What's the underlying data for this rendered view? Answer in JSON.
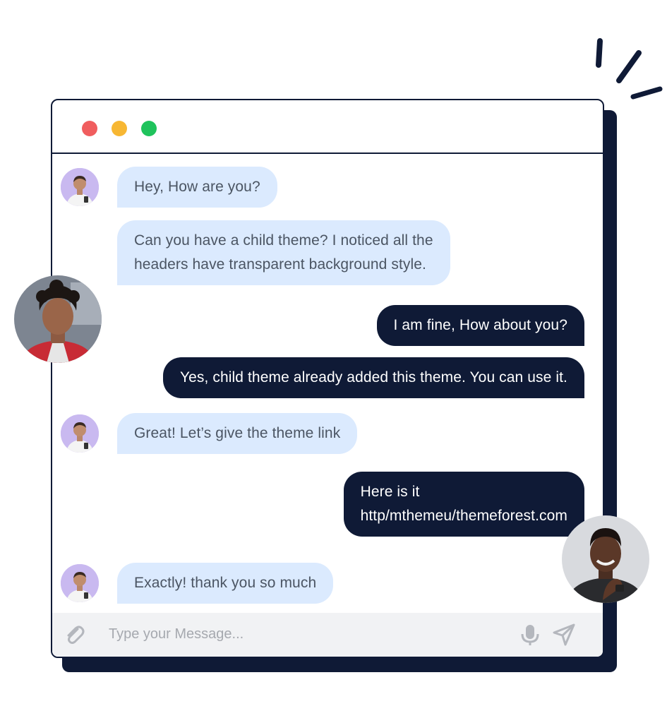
{
  "window": {
    "controls": [
      "close",
      "minimize",
      "maximize"
    ]
  },
  "messages": [
    {
      "side": "in",
      "lines": [
        "Hey, How are you?"
      ],
      "avatar": "mini"
    },
    {
      "side": "in",
      "lines": [
        "Can you have a child theme? I noticed all the",
        "headers have transparent background style."
      ],
      "avatar": "none"
    },
    {
      "side": "out",
      "lines": [
        "I am fine, How about you?"
      ]
    },
    {
      "side": "out",
      "lines": [
        "Yes, child theme already added this theme. You can use it."
      ]
    },
    {
      "side": "in",
      "lines": [
        "Great! Let’s give the theme link"
      ],
      "avatar": "mini"
    },
    {
      "side": "out",
      "lines": [
        "Here is it",
        "http/mthemeu/themeforest.com"
      ]
    },
    {
      "side": "in",
      "lines": [
        "Exactly! thank you so much"
      ],
      "avatar": "mini"
    }
  ],
  "composer": {
    "placeholder": "Type your Message...",
    "attach_icon": "paperclip-icon",
    "mic_icon": "microphone-icon",
    "send_icon": "send-icon"
  },
  "colors": {
    "navy": "#0f1a36",
    "incoming_bubble": "#dbeafe",
    "close": "#f05d5e",
    "minimize": "#f7b733",
    "maximize": "#1fc35c"
  }
}
